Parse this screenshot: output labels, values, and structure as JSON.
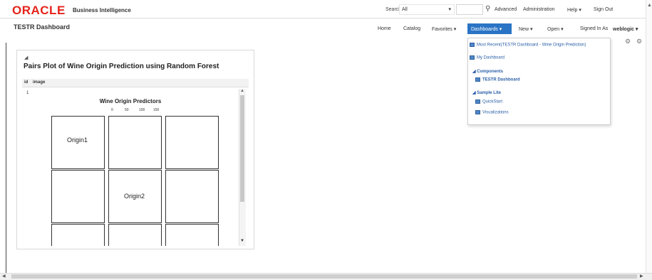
{
  "app": {
    "brand": "ORACLE",
    "brand_sub": "Business Intelligence"
  },
  "topbar": {
    "search_label": "Search",
    "search_scope": "All",
    "advanced": "Advanced",
    "administration": "Administration",
    "help": "Help ▾",
    "sign_out": "Sign Out"
  },
  "dashbar": {
    "title": "TESTR Dashboard",
    "home": "Home",
    "catalog": "Catalog",
    "favorites": "Favorites ▾",
    "dashboards": "Dashboards ▾",
    "new": "New ▾",
    "open": "Open ▾",
    "signed_in_prefix": "Signed In As",
    "user": "weblogic ▾"
  },
  "panel": {
    "title": "Pairs Plot of Wine Origin Prediction using Random Forest",
    "col_id": "id",
    "col_image": "image",
    "row_id": "1",
    "plot_title": "Wine Origin Predictors",
    "origin1": "Origin1",
    "origin2": "Origin2",
    "top_ticks": [
      "0",
      "50",
      "100",
      "150"
    ]
  },
  "menu": {
    "most_recent": "Most Recent(TESTR Dashboard - Wine Origin Prediction)",
    "my_dashboard": "My Dashboard",
    "components": "Components",
    "testr_dashboard": "TESTR Dashboard",
    "sample_lite": "Sample Lite",
    "quickstart": "QuickStart",
    "visualizations": "Visualizations"
  }
}
